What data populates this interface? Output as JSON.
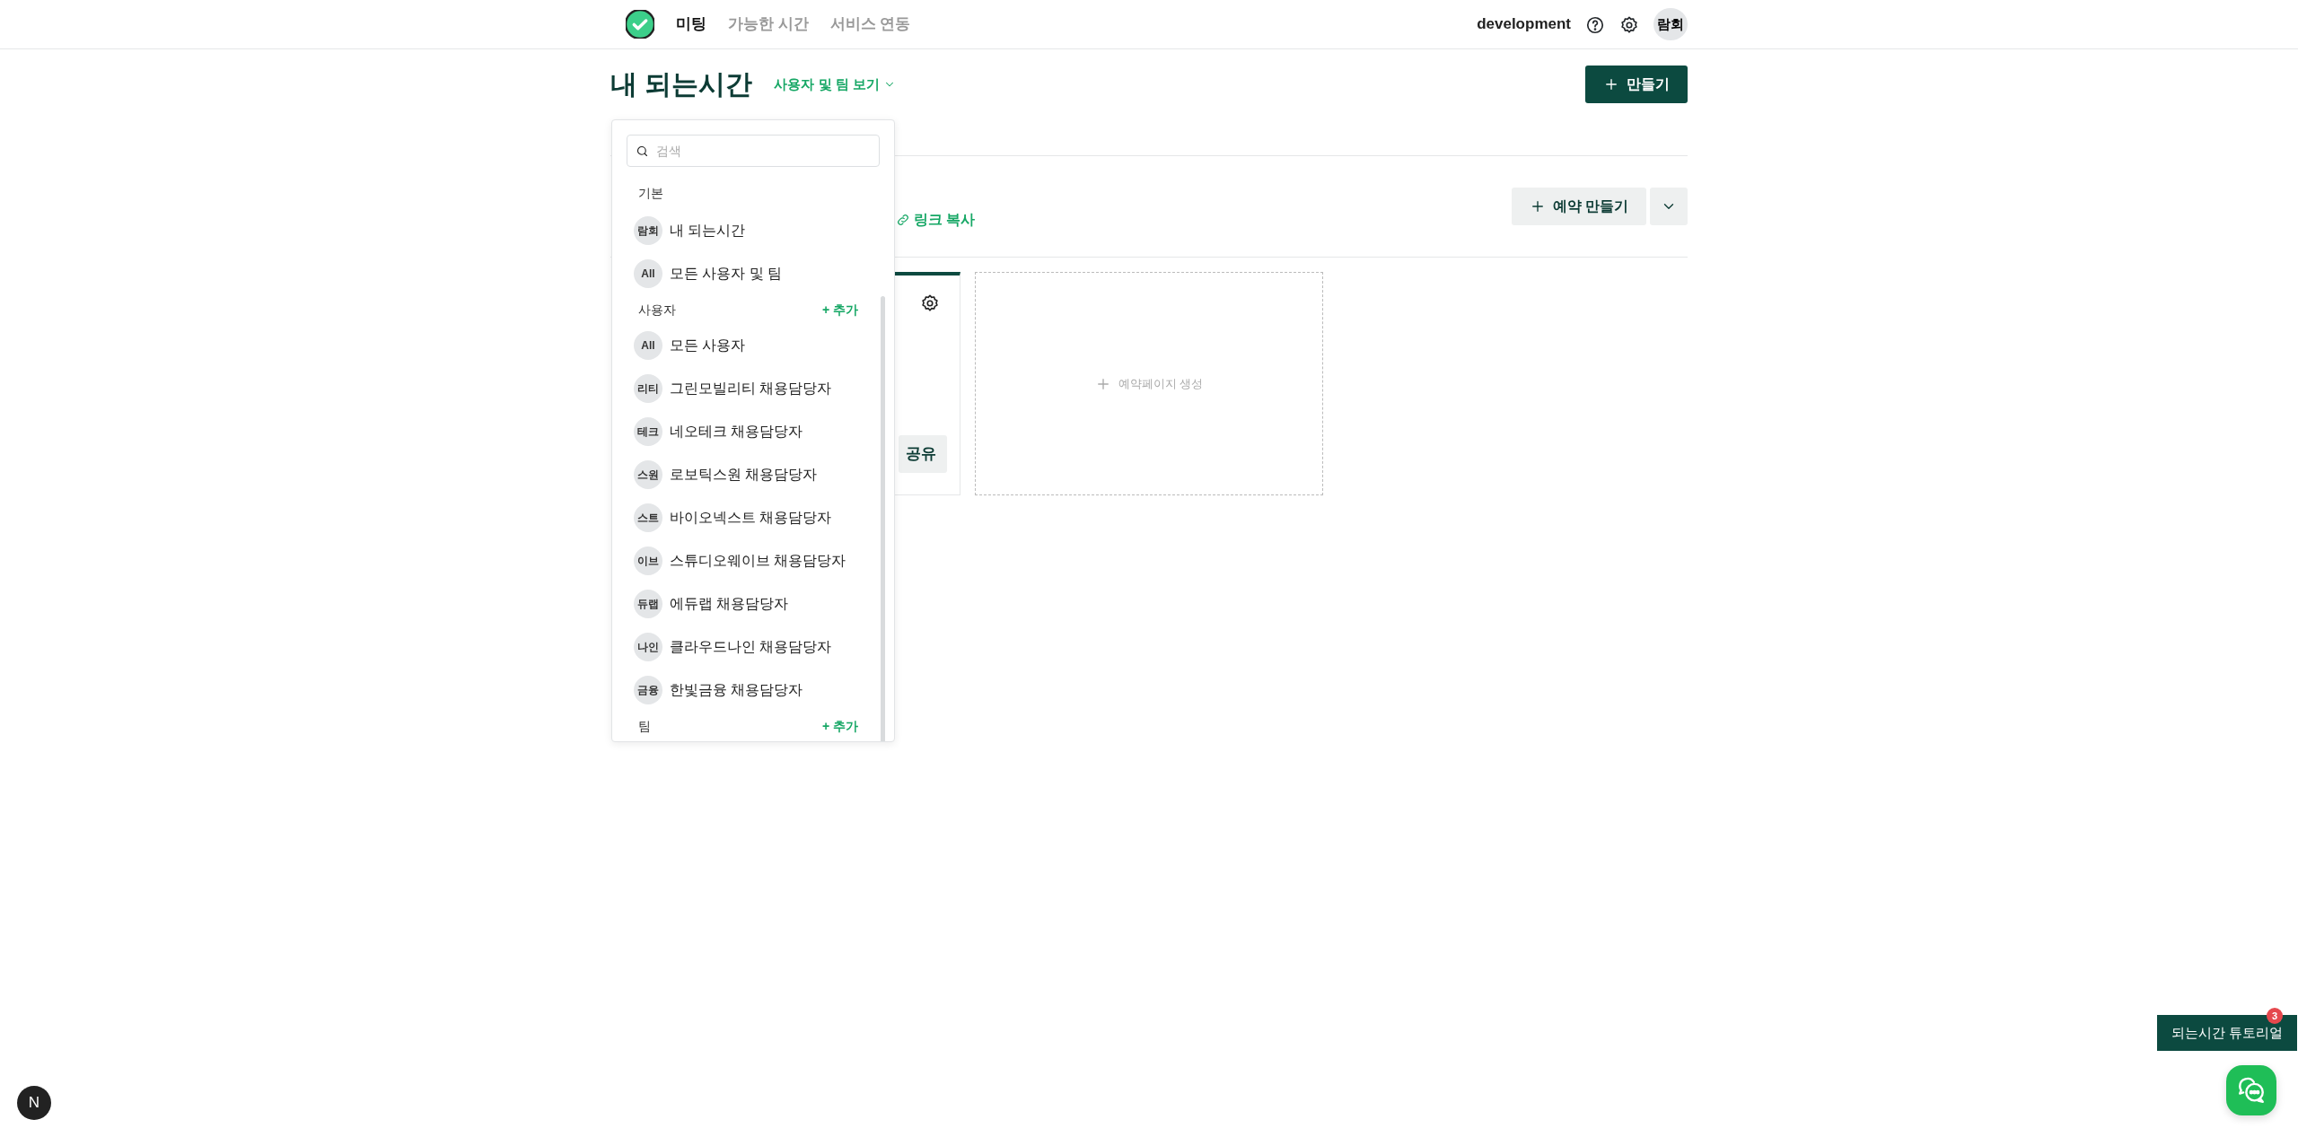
{
  "header": {
    "nav": [
      {
        "label": "미팅",
        "selected": true
      },
      {
        "label": "가능한 시간",
        "selected": false
      },
      {
        "label": "서비스 연동",
        "selected": false
      }
    ],
    "workspace": "development",
    "avatar": "람회"
  },
  "page": {
    "title": "내 되는시간",
    "view_toggle": "사용자 및 팀 보기",
    "create_button": "만들기"
  },
  "toolbar": {
    "copy_link": "링크 복사",
    "booking_button": "예약 만들기"
  },
  "cards": [
    {
      "kind": "page",
      "share_button": "공유"
    },
    {
      "kind": "new",
      "label": "예약페이지 생성"
    }
  ],
  "dropdown": {
    "search": {
      "placeholder": "검색"
    },
    "sections": [
      {
        "title": "기본",
        "items": [
          {
            "avatar": "람회",
            "label": "내 되는시간"
          },
          {
            "avatar": "All",
            "label": "모든 사용자 및 팀"
          }
        ]
      },
      {
        "title": "사용자",
        "add": "+ 추가",
        "items": [
          {
            "avatar": "All",
            "label": "모든 사용자"
          },
          {
            "avatar": "리티",
            "label": "그린모빌리티 채용담당자"
          },
          {
            "avatar": "테크",
            "label": "네오테크 채용담당자"
          },
          {
            "avatar": "스원",
            "label": "로보틱스원 채용담당자"
          },
          {
            "avatar": "스트",
            "label": "바이오넥스트 채용담당자"
          },
          {
            "avatar": "이브",
            "label": "스튜디오웨이브 채용담당자"
          },
          {
            "avatar": "듀랩",
            "label": "에듀랩 채용담당자"
          },
          {
            "avatar": "나인",
            "label": "클라우드나인 채용담당자"
          },
          {
            "avatar": "금융",
            "label": "한빛금융 채용담당자"
          }
        ]
      },
      {
        "title": "팀",
        "add": "+ 추가"
      }
    ]
  },
  "tutorial": {
    "label": "되는시간 튜토리얼",
    "badge": "3"
  },
  "dev_indicator": "N"
}
